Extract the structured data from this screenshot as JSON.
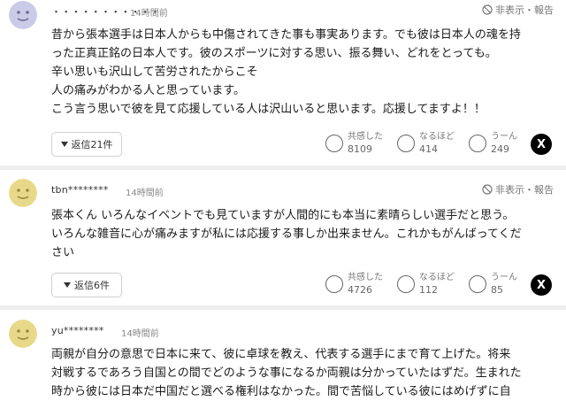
{
  "report_label": "非表示・報告",
  "reactions": {
    "agree": "共感した",
    "insight": "なるほど",
    "hmm": "うーん"
  },
  "share_x": "X",
  "comments": [
    {
      "user": "・・・・・・・・・・・",
      "time": "14時間前",
      "lines": [
        "昔から張本選手は日本人からも中傷されてきた事も事実あります。でも彼は日本人の魂を持",
        "った正真正銘の日本人です。彼のスポーツに対する思い、振る舞い、どれをとっても。",
        "辛い思いも沢山して苦労されたからこそ",
        "人の痛みがわかる人と思っています。",
        "こう言う思いで彼を見て応援している人は沢山いると思います。応援してますよ！！"
      ],
      "reply": "返信21件",
      "agree": "8109",
      "insight": "414",
      "hmm": "249"
    },
    {
      "user": "tbn********",
      "time": "14時間前",
      "lines": [
        "張本くん いろんなイベントでも見ていますが人間的にも本当に素晴らしい選手だと思う。",
        "いろんな雑音に心が痛みますが私には応援する事しか出来ません。これかもがんばってくだ",
        "さい"
      ],
      "reply": "返信6件",
      "agree": "4726",
      "insight": "112",
      "hmm": "85"
    },
    {
      "user": "yu********",
      "time": "14時間前",
      "lines": [
        "両親が自分の意思で日本に来て、彼に卓球を教え、代表する選手にまで育て上げた。将来",
        "対戦するであろう自国との間でどのような事になるか両親は分かっていたはずだ。生まれた",
        "時から彼には日本だ中国だと選べる権利はなかった。間で苦悩している彼にはめげずに自"
      ]
    }
  ],
  "colors": {
    "avatar": "#e8d98a",
    "avatar_first": "#c9cbe8",
    "separator": "#eeeeee"
  }
}
